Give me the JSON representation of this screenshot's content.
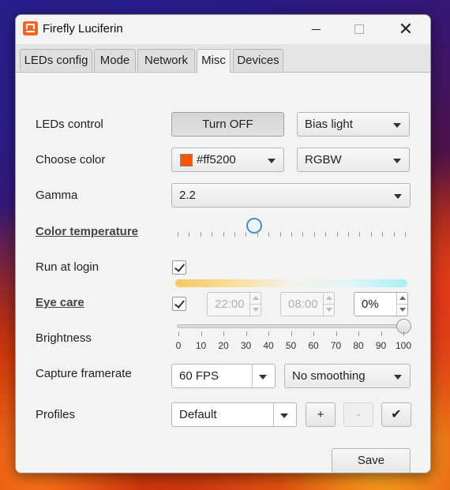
{
  "window": {
    "title": "Firefly Luciferin"
  },
  "tabs": [
    {
      "label": "LEDs config"
    },
    {
      "label": "Mode"
    },
    {
      "label": "Network"
    },
    {
      "label": "Misc",
      "active": true
    },
    {
      "label": "Devices"
    }
  ],
  "leds_control": {
    "label": "LEDs control",
    "button": "Turn OFF",
    "mode": "Bias light"
  },
  "choose_color": {
    "label": "Choose color",
    "color_value": "#ff5200",
    "color_swatch": "#ff5200",
    "format": "RGBW"
  },
  "gamma": {
    "label": "Gamma",
    "value": "2.2"
  },
  "color_temperature": {
    "label": "Color temperature",
    "level_fraction": 0.34
  },
  "run_at_login": {
    "label": "Run at login",
    "checked": true
  },
  "eye_care": {
    "label": "Eye care",
    "checked": true,
    "start_time": "22:00",
    "end_time": "08:00",
    "percent": "0%"
  },
  "brightness": {
    "label": "Brightness",
    "value": 100,
    "tick_labels": [
      "0",
      "10",
      "20",
      "30",
      "40",
      "50",
      "60",
      "70",
      "80",
      "90",
      "100"
    ]
  },
  "capture_framerate": {
    "label": "Capture framerate",
    "fps": "60 FPS",
    "smoothing": "No smoothing"
  },
  "profiles": {
    "label": "Profiles",
    "selected": "Default",
    "add": "+",
    "remove": "-",
    "apply": "✔"
  },
  "save": {
    "label": "Save"
  },
  "icons": {
    "app": "luciferin-monitor-icon",
    "minimize": "minimize-icon",
    "maximize": "maximize-icon",
    "close": "close-icon"
  }
}
